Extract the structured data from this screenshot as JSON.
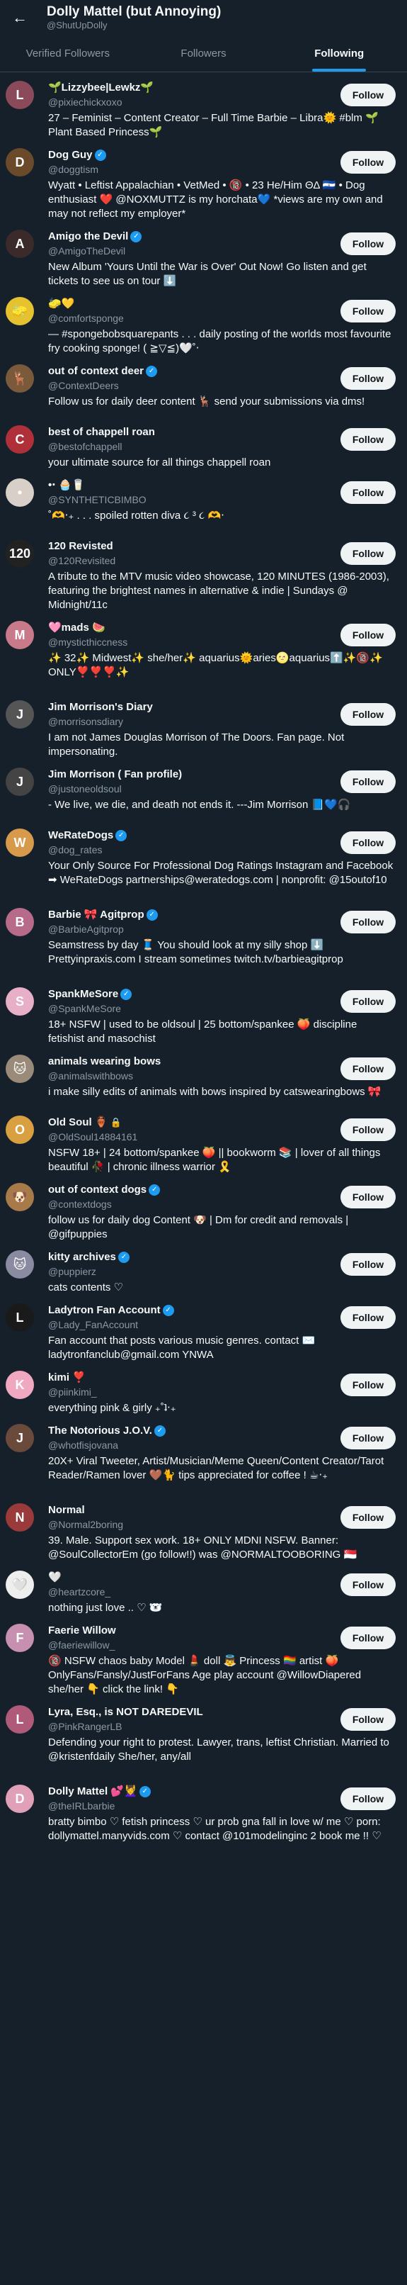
{
  "header": {
    "back_icon": "arrow-left-icon",
    "title": "Dolly Mattel (but Annoying)",
    "handle": "@ShutUpDolly"
  },
  "tabs": [
    {
      "label": "Verified Followers"
    },
    {
      "label": "Followers"
    },
    {
      "label": "Following"
    }
  ],
  "follow_label": "Follow",
  "users": [
    {
      "name": "🌱Lizzybee|Lewkz🌱",
      "handle": "@pixiechickxoxo",
      "bio": "27 – Feminist – Content Creator – Full Time Barbie – Libra🌞 #blm 🌱Plant Based Princess🌱",
      "verified": false,
      "avatar_color": "#8a4a5a",
      "avatar_glyph": "L"
    },
    {
      "name": "Dog Guy",
      "handle": "@doggtism",
      "bio": "Wyatt • Leftist Appalachian • VetMed • 🔞 • 23 He/Him ΘΔ 🇸🇻 • Dog enthusiast ❤️ @NOXMUTTZ is my horchata💙 *views are my own and may not reflect my employer*",
      "verified": true,
      "avatar_color": "#6b4a2a",
      "avatar_glyph": "D"
    },
    {
      "name": "Amigo the Devil",
      "handle": "@AmigoTheDevil",
      "bio": "New Album 'Yours Until the War is Over' Out Now! Go listen and get tickets to see us on tour ⬇️",
      "verified": true,
      "avatar_color": "#3a2a2a",
      "avatar_glyph": "A"
    },
    {
      "name": "🧽💛",
      "handle": "@comfortsponge",
      "bio": "— #spongebobsquarepants . . . daily posting of the worlds most favourite fry cooking sponge! ( ≧▽≦)🤍˚‧",
      "verified": false,
      "avatar_color": "#e6c230",
      "avatar_glyph": "🧽"
    },
    {
      "name": "out of context deer",
      "handle": "@ContextDeers",
      "bio": "Follow us for daily deer content 🦌 send your submissions via dms!",
      "verified": true,
      "avatar_color": "#7a5a3a",
      "avatar_glyph": "🦌"
    },
    {
      "name": "best of chappell roan",
      "handle": "@bestofchappell",
      "bio": "your ultimate source for all things chappell roan",
      "verified": false,
      "avatar_color": "#b0303a",
      "avatar_glyph": "C"
    },
    {
      "name": "•‧⁠ 🧁🥛",
      "handle": "@SYNTHETICBIMBO",
      "bio": "˚🫶‧₊ . . . spoiled rotten diva ૮ ³ ૮ 🫶‧",
      "verified": false,
      "avatar_color": "#d8cfc8",
      "avatar_glyph": "•"
    },
    {
      "name": "120 Revisted",
      "handle": "@120Revisited",
      "bio": "A tribute to the MTV music video showcase, 120 MINUTES (1986-2003), featuring the brightest names in alternative & indie | Sundays @ Midnight/11c",
      "verified": false,
      "avatar_color": "#222222",
      "avatar_glyph": "120"
    },
    {
      "name": "🩷mads 🍉",
      "handle": "@mysticthiccness",
      "bio": "✨ 32✨ Midwest✨ she/her✨ aquarius🌞aries🌝aquarius⬆️✨🔞✨ ONLY❣️❣️❣️✨",
      "verified": false,
      "avatar_color": "#c97a8a",
      "avatar_glyph": "M"
    },
    {
      "name": "Jim Morrison's Diary",
      "handle": "@morrisonsdiary",
      "bio": "I am not James Douglas Morrison of The Doors. Fan page. Not impersonating.",
      "verified": false,
      "avatar_color": "#555555",
      "avatar_glyph": "J"
    },
    {
      "name": "Jim Morrison ( Fan profile)",
      "handle": "@justoneoldsoul",
      "bio": "- We live, we die, and death not ends it. ---Jim Morrison 📘💙🎧",
      "verified": false,
      "avatar_color": "#444444",
      "avatar_glyph": "J"
    },
    {
      "name": "WeRateDogs",
      "handle": "@dog_rates",
      "bio": "Your Only Source For Professional Dog Ratings Instagram and Facebook ➡ WeRateDogs partnerships@weratedogs.com | nonprofit: @15outof10",
      "verified": true,
      "avatar_color": "#d69a4a",
      "avatar_glyph": "W"
    },
    {
      "name": "Barbie 🎀 Agitprop",
      "handle": "@BarbieAgitprop",
      "bio": "Seamstress by day 🧵 You should look at my silly shop ⬇️ Prettyinpraxis.com I stream sometimes twitch.tv/barbieagitprop",
      "verified": true,
      "avatar_color": "#b86a8a",
      "avatar_glyph": "B"
    },
    {
      "name": "SpankMeSore",
      "handle": "@SpankMeSore",
      "bio": "18+ NSFW | used to be oldsoul | 25 bottom/spankee 🍑 discipline fetishist and masochist",
      "verified": true,
      "avatar_color": "#e8b0c8",
      "avatar_glyph": "S"
    },
    {
      "name": "animals wearing bows",
      "handle": "@animalswithbows",
      "bio": "i make silly edits of animals with bows inspired by catswearingbows 🎀",
      "verified": false,
      "avatar_color": "#9a8a7a",
      "avatar_glyph": "🐱"
    },
    {
      "name": "Old Soul 🏺",
      "handle": "@OldSoul14884161",
      "bio": "NSFW 18+ | 24 bottom/spankee 🍑 || bookworm 📚 | lover of all things beautiful 🥀 | chronic illness warrior 🎗️",
      "verified": false,
      "lock": true,
      "avatar_color": "#d8a040",
      "avatar_glyph": "O"
    },
    {
      "name": "out of context dogs",
      "handle": "@contextdogs",
      "bio": "follow us for daily dog Content 🐶 | Dm for credit and removals | @gifpuppies",
      "verified": true,
      "avatar_color": "#a87a4a",
      "avatar_glyph": "🐶"
    },
    {
      "name": "kitty archives",
      "handle": "@puppierz",
      "bio": "cats contents ♡",
      "verified": true,
      "avatar_color": "#8a8aa0",
      "avatar_glyph": "🐱"
    },
    {
      "name": "Ladytron Fan Account",
      "handle": "@Lady_FanAccount",
      "bio": "Fan account that posts various music genres. contact ✉️ ladytronfanclub@gmail.com YNWA",
      "verified": true,
      "avatar_color": "#1a1a1a",
      "avatar_glyph": "L"
    },
    {
      "name": "kimi ❣️",
      "handle": "@piinkimi_",
      "bio": "everything pink & girly ₊˚ʇ‧₊",
      "verified": false,
      "avatar_color": "#f0a8c0",
      "avatar_glyph": "K"
    },
    {
      "name": "The Notorious J.O.V.",
      "handle": "@whotfisjovana",
      "bio": "20X+ Viral Tweeter, Artist/Musician/Meme Queen/Content Creator/Tarot Reader/Ramen lover 🤎🐈 tips appreciated for coffee ! ☕‧₊︎",
      "verified": true,
      "avatar_color": "#6a4a3a",
      "avatar_glyph": "J"
    },
    {
      "name": "Normal",
      "handle": "@Normal2boring",
      "bio": "39. Male. Support sex work. 18+ ONLY MDNI NSFW. Banner: @SoulCollectorEm (go follow!!) was @NORMALTOOBORING 🇸🇬",
      "verified": false,
      "avatar_color": "#9a3a3a",
      "avatar_glyph": "N"
    },
    {
      "name": "🤍",
      "handle": "@heartzcore_",
      "bio": "nothing just love .. ♡ 🐻‍❄️",
      "verified": false,
      "avatar_color": "#eeeeee",
      "avatar_glyph": "🤍"
    },
    {
      "name": "Faerie Willow",
      "handle": "@faeriewillow_",
      "bio": "🔞 NSFW chaos baby Model 💄 doll 👼 Princess 🏳️‍🌈 artist 🍑 OnlyFans/Fansly/JustForFans Age play account @WillowDiapered she/her 👇 click the link! 👇",
      "verified": false,
      "avatar_color": "#c890b0",
      "avatar_glyph": "F"
    },
    {
      "name": "Lyra, Esq., is NOT DAREDEVIL",
      "handle": "@PinkRangerLB",
      "bio": "Defending your right to protest. Lawyer, trans, leftist Christian. Married to @kristenfdaily She/her, any/all",
      "verified": false,
      "avatar_color": "#b05a7a",
      "avatar_glyph": "L"
    },
    {
      "name": "Dolly Mattel 💕💆‍♀️",
      "handle": "@theIRLbarbie",
      "bio": "bratty bimbo ♡ fetish princess ♡ ur prob gna fall in love w/ me ♡ porn: dollymattel.manyvids.com ♡ contact @101modelinginc 2 book me !! ♡",
      "verified": true,
      "avatar_color": "#e0a0b8",
      "avatar_glyph": "D"
    }
  ]
}
